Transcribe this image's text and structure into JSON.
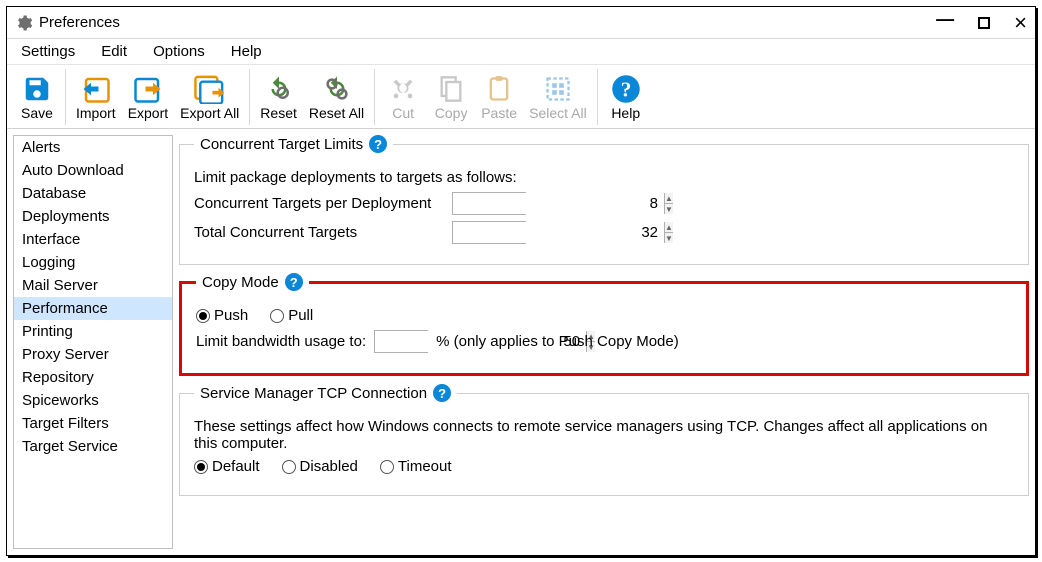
{
  "window": {
    "title": "Preferences"
  },
  "menu": {
    "settings": "Settings",
    "edit": "Edit",
    "options": "Options",
    "help": "Help"
  },
  "toolbar": {
    "save": "Save",
    "import": "Import",
    "export": "Export",
    "export_all": "Export All",
    "reset": "Reset",
    "reset_all": "Reset All",
    "cut": "Cut",
    "copy": "Copy",
    "paste": "Paste",
    "select_all": "Select All",
    "help": "Help"
  },
  "sidebar": {
    "items": [
      "Alerts",
      "Auto Download",
      "Database",
      "Deployments",
      "Interface",
      "Logging",
      "Mail Server",
      "Performance",
      "Printing",
      "Proxy Server",
      "Repository",
      "Spiceworks",
      "Target Filters",
      "Target Service"
    ],
    "selected_index": 7
  },
  "section1": {
    "legend": "Concurrent Target Limits",
    "desc": "Limit package deployments to targets as follows:",
    "row1_label": "Concurrent Targets per Deployment",
    "row1_value": "8",
    "row2_label": "Total Concurrent Targets",
    "row2_value": "32"
  },
  "section2": {
    "legend": "Copy Mode",
    "radio_push": "Push",
    "radio_pull": "Pull",
    "bw_label": "Limit bandwidth usage to:",
    "bw_value": "50",
    "bw_suffix": "% (only applies to Push Copy Mode)"
  },
  "section3": {
    "legend": "Service Manager TCP Connection",
    "desc": "These settings affect how Windows connects to remote service managers using TCP. Changes affect all applications on this computer.",
    "radio_default": "Default",
    "radio_disabled": "Disabled",
    "radio_timeout": "Timeout"
  }
}
